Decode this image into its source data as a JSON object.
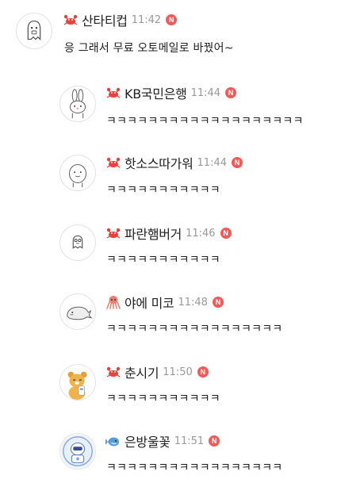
{
  "comments": [
    {
      "author": "산타티컵",
      "author_icon": "crab-icon",
      "time": "11:42",
      "badge": "N",
      "text": "응 그래서 무료 오토메일로 바꿨어~",
      "avatar": "ghost-character-avatar"
    },
    {
      "author": "KB국민은행",
      "author_icon": "crab-icon",
      "time": "11:44",
      "badge": "N",
      "text": "ㅋㅋㅋㅋㅋㅋㅋㅋㅋㅋㅋㅋㅋㅋㅋㅋㅋㅋㅋ",
      "avatar": "bunny-avatar"
    },
    {
      "author": "핫소스따가워",
      "author_icon": "crab-icon",
      "time": "11:44",
      "badge": "N",
      "text": "ㅋㅋㅋㅋㅋㅋㅋㅋㅋㅋㅋ",
      "avatar": "round-character-avatar"
    },
    {
      "author": "파란햄버거",
      "author_icon": "crab-icon",
      "time": "11:46",
      "badge": "N",
      "text": "ㅋㅋㅋㅋㅋㅋㅋㅋㅋㅋㅋ",
      "avatar": "small-ghost-avatar"
    },
    {
      "author": "야에 미코",
      "author_icon": "octopus-icon",
      "time": "11:48",
      "badge": "N",
      "text": "ㅋㅋㅋㅋㅋㅋㅋㅋㅋㅋㅋㅋㅋㅋㅋㅋㅋ",
      "avatar": "seal-avatar"
    },
    {
      "author": "춘시기",
      "author_icon": "crab-icon",
      "time": "11:50",
      "badge": "N",
      "text": "ㅋㅋㅋㅋㅋㅋㅋㅋㅋㅋㅋ",
      "avatar": "bear-character-avatar"
    },
    {
      "author": "은방울꽃",
      "author_icon": "fish-icon",
      "time": "11:51",
      "badge": "N",
      "text": "ㅋㅋㅋㅋㅋㅋㅋㅋㅋㅋㅋㅋㅋㅋㅋㅋㅋ",
      "avatar": "robot-character-avatar"
    }
  ],
  "colors": {
    "badge": "#f25a5a",
    "timestamp": "#999999",
    "text": "#222222"
  }
}
